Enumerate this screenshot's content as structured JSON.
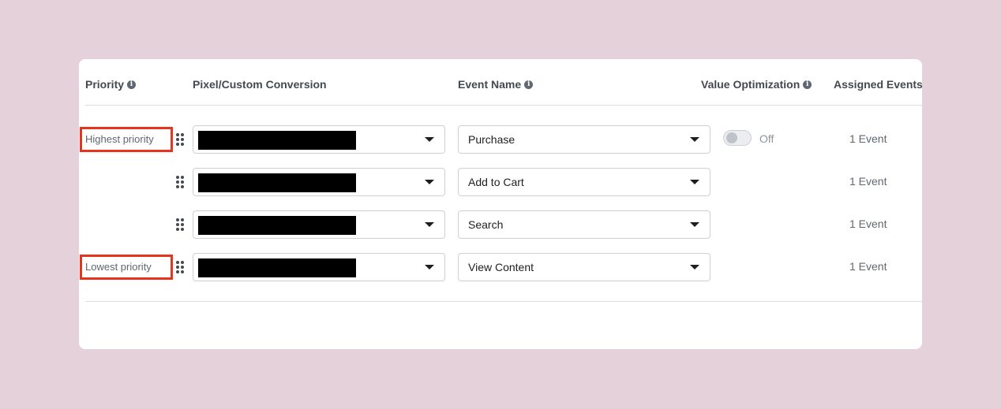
{
  "headers": {
    "priority": "Priority",
    "pixel": "Pixel/Custom Conversion",
    "event_name": "Event Name",
    "value_optimization": "Value Optimization",
    "assigned_events": "Assigned Events",
    "info_icon": "i"
  },
  "rows": [
    {
      "priority_label": "Highest priority",
      "pixel_value": "",
      "event": "Purchase",
      "value_optimization": "Off",
      "assigned": "1 Event"
    },
    {
      "priority_label": "",
      "pixel_value": "",
      "event": "Add to Cart",
      "value_optimization": "",
      "assigned": "1 Event"
    },
    {
      "priority_label": "",
      "pixel_value": "",
      "event": "Search",
      "value_optimization": "",
      "assigned": "1 Event"
    },
    {
      "priority_label": "Lowest priority",
      "pixel_value": "",
      "event": "View Content",
      "value_optimization": "",
      "assigned": "1 Event"
    }
  ],
  "icons": {
    "info": "info-icon",
    "drag": "drag-handle-icon",
    "caret": "caret-down-icon"
  },
  "colors": {
    "background": "#e5d1da",
    "highlight_border": "#e8341c",
    "redaction": "#000000"
  }
}
